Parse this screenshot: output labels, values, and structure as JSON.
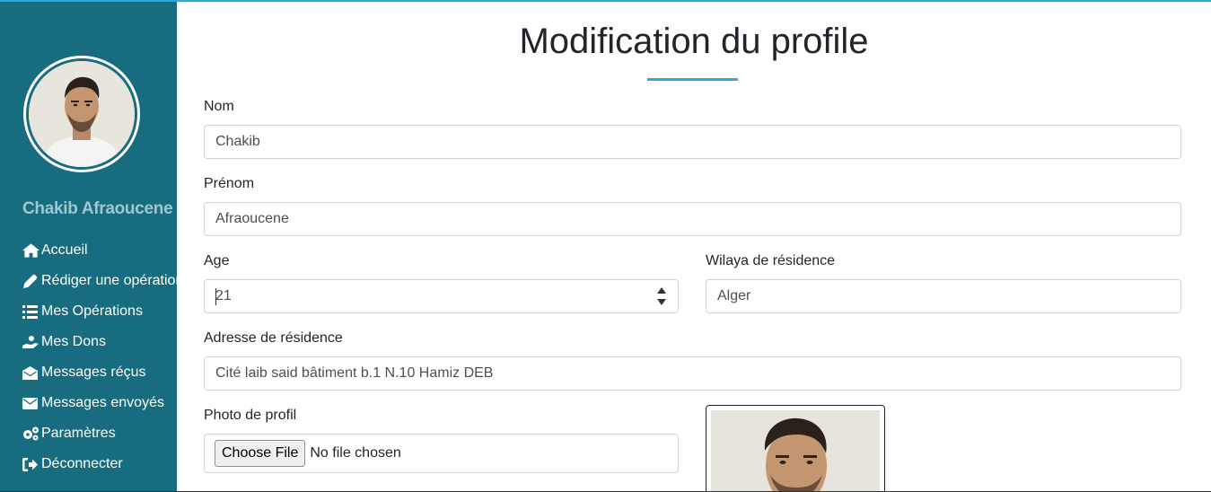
{
  "sidebar": {
    "username": "Chakib Afraoucene",
    "avatar_icon": "profile-photo",
    "items": [
      {
        "label": "Accueil",
        "icon": "home-icon"
      },
      {
        "label": "Rédiger une opération",
        "icon": "pen-icon"
      },
      {
        "label": "Mes Opérations",
        "icon": "list-icon"
      },
      {
        "label": "Mes Dons",
        "icon": "hand-holding-icon"
      },
      {
        "label": "Messages réçus",
        "icon": "envelope-open-icon"
      },
      {
        "label": "Messages envoyés",
        "icon": "envelope-icon"
      },
      {
        "label": "Paramètres",
        "icon": "cogs-icon"
      },
      {
        "label": "Déconnecter",
        "icon": "sign-out-icon"
      }
    ]
  },
  "page": {
    "title": "Modification du profile"
  },
  "form": {
    "nom": {
      "label": "Nom",
      "value": "Chakib"
    },
    "prenom": {
      "label": "Prénom",
      "value": "Afraoucene"
    },
    "age": {
      "label": "Age",
      "value": "21"
    },
    "wilaya": {
      "label": "Wilaya de résidence",
      "value": "Alger"
    },
    "adresse": {
      "label": "Adresse de résidence",
      "value": "Cité laib said bâtiment b.1 N.10 Hamiz DEB"
    },
    "photo": {
      "label": "Photo de profil",
      "button": "Choose File",
      "status": "No file chosen"
    }
  },
  "colors": {
    "sidebar_bg": "#176c80",
    "accent": "#29abe2",
    "username": "#9fc7d1"
  }
}
